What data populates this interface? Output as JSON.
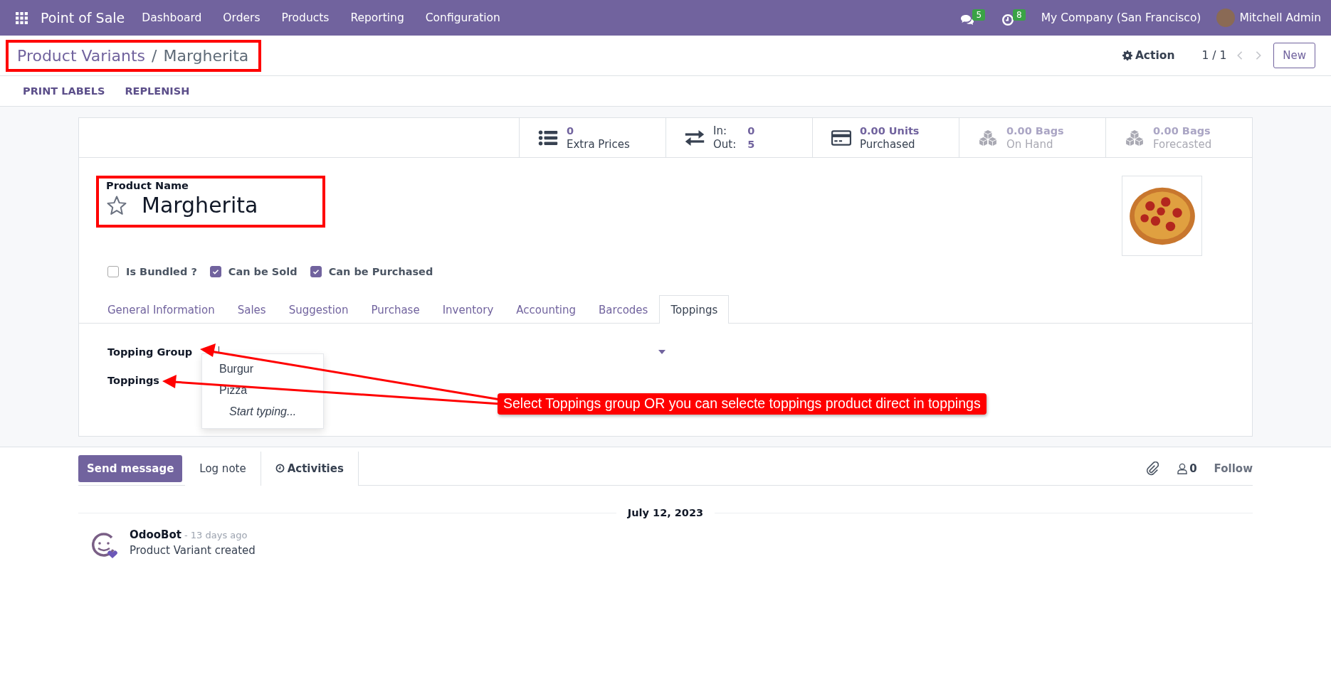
{
  "navbar": {
    "app_name": "Point of Sale",
    "menu": [
      "Dashboard",
      "Orders",
      "Products",
      "Reporting",
      "Configuration"
    ],
    "messages_count": "5",
    "activities_count": "8",
    "company": "My Company (San Francisco)",
    "user": "Mitchell Admin"
  },
  "breadcrumb": {
    "parent": "Product Variants",
    "separator": "/",
    "current": "Margherita"
  },
  "control_panel": {
    "action": "Action",
    "pager": "1 / 1",
    "new_button": "New"
  },
  "action_buttons": [
    "PRINT LABELS",
    "REPLENISH"
  ],
  "stat_buttons": [
    {
      "kind": "list",
      "value": "0",
      "label": "Extra Prices",
      "disabled": false
    },
    {
      "kind": "transfer",
      "in_label": "In:",
      "in_value": "0",
      "out_label": "Out:",
      "out_value": "5",
      "disabled": false
    },
    {
      "kind": "card",
      "value": "0.00 Units",
      "label": "Purchased",
      "disabled": false
    },
    {
      "kind": "cubes",
      "value": "0.00 Bags",
      "label": "On Hand",
      "disabled": true
    },
    {
      "kind": "cubes",
      "value": "0.00 Bags",
      "label": "Forecasted",
      "disabled": true
    }
  ],
  "product": {
    "name_label": "Product Name",
    "name": "Margherita",
    "favorite": false
  },
  "checkboxes": [
    {
      "label": "Is Bundled ?",
      "checked": false
    },
    {
      "label": "Can be Sold",
      "checked": true
    },
    {
      "label": "Can be Purchased",
      "checked": true
    }
  ],
  "tabs": [
    {
      "label": "General Information",
      "selected": false
    },
    {
      "label": "Sales",
      "selected": false
    },
    {
      "label": "Suggestion",
      "selected": false
    },
    {
      "label": "Purchase",
      "selected": false
    },
    {
      "label": "Inventory",
      "selected": false
    },
    {
      "label": "Accounting",
      "selected": false
    },
    {
      "label": "Barcodes",
      "selected": false
    },
    {
      "label": "Toppings",
      "selected": true
    }
  ],
  "toppings_fields": [
    {
      "label": "Topping Group"
    },
    {
      "label": "Toppings"
    }
  ],
  "dropdown": {
    "options": [
      "Burgur",
      "Pizza"
    ],
    "hint": "Start typing..."
  },
  "annotation": {
    "text": "Select Toppings group OR you can selecte toppings product direct in toppings"
  },
  "chatter": {
    "buttons": [
      {
        "kind": "message",
        "label": "Send message",
        "selected": true
      },
      {
        "kind": "note",
        "label": "Log note",
        "selected": false
      },
      {
        "kind": "activities",
        "label": "Activities",
        "selected": false
      }
    ],
    "followers_count": "0",
    "follow": "Follow",
    "date": "July 12, 2023",
    "messages": [
      {
        "author": "OdooBot",
        "time": "- 13 days ago",
        "body": "Product Variant created"
      }
    ]
  }
}
